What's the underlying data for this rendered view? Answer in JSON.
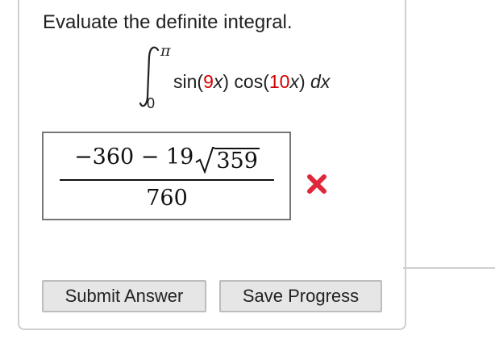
{
  "question": {
    "prompt": "Evaluate the definite integral.",
    "integral": {
      "upper_limit": "π",
      "lower_limit": "0",
      "sin_prefix": "sin(",
      "sin_coeff": "9",
      "sin_var": "x",
      "sin_suffix": ")",
      "cos_prefix": " cos(",
      "cos_coeff": "10",
      "cos_var": "x",
      "cos_suffix": ")",
      "differential": "dx"
    }
  },
  "answer": {
    "numerator_left": "−360 − 19",
    "numerator_radicand": "359",
    "denominator": "760",
    "status": "incorrect",
    "status_icon": "x-mark-icon",
    "status_color": "#e0283a"
  },
  "buttons": {
    "submit_label": "Submit Answer",
    "save_label": "Save Progress"
  },
  "colors": {
    "coefficient": "#d40000",
    "border": "#cfcfcf",
    "button_bg": "#e6e6e6"
  }
}
